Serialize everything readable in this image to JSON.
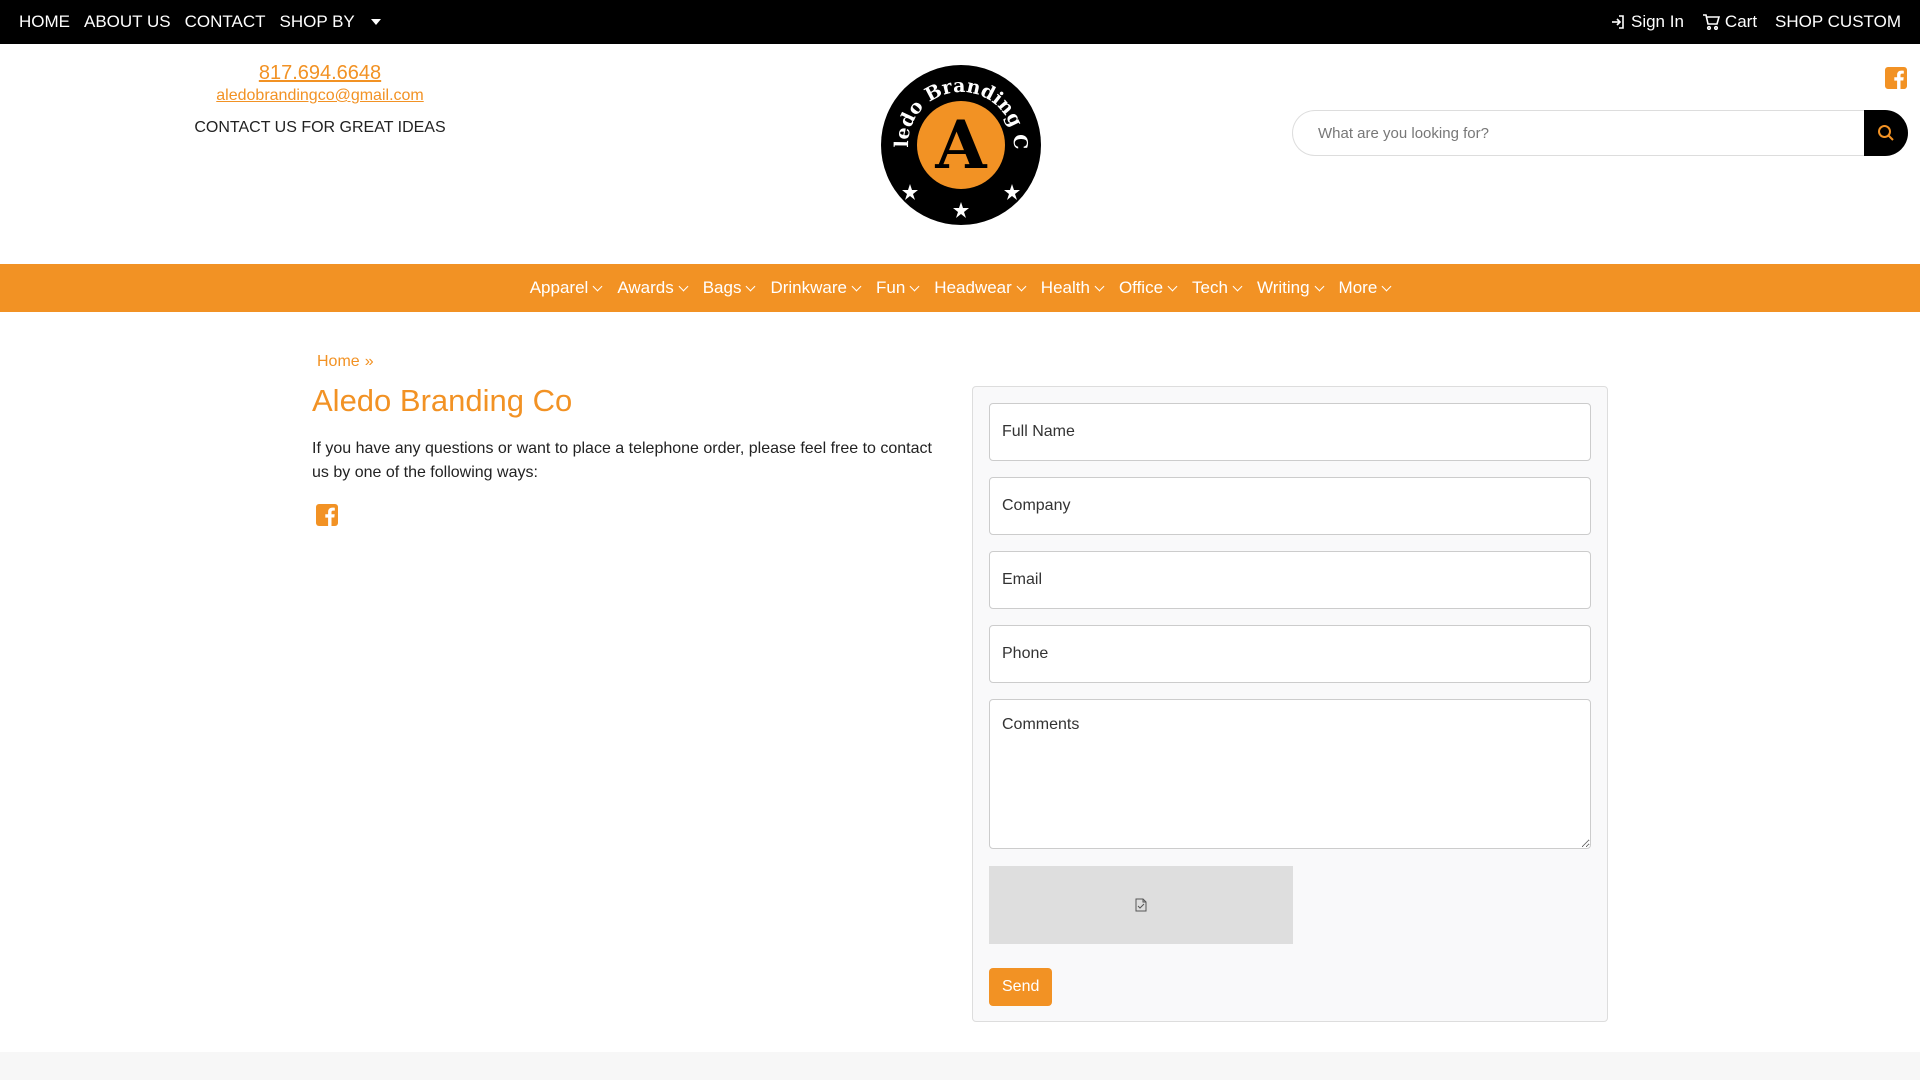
{
  "topbar": {
    "home": "HOME",
    "about": "ABOUT US",
    "contact": "CONTACT",
    "shop_by": "SHOP BY",
    "sign_in": "Sign In",
    "cart": "Cart",
    "shop_custom": "SHOP CUSTOM"
  },
  "header": {
    "phone": "817.694.6648",
    "email": "aledobrandingco@gmail.com",
    "tagline": "CONTACT US FOR GREAT IDEAS",
    "logo_text": "Aledo Branding Co",
    "logo_letter": "A",
    "search_placeholder": "What are you looking for?"
  },
  "categories": [
    "Apparel",
    "Awards",
    "Bags",
    "Drinkware",
    "Fun",
    "Headwear",
    "Health",
    "Office",
    "Tech",
    "Writing",
    "More"
  ],
  "breadcrumb": {
    "home": "Home",
    "sep": "»"
  },
  "main": {
    "title": "Aledo Branding Co",
    "intro": "If you have any questions or want to place a telephone order, please feel free to contact us by one of the following ways:"
  },
  "form": {
    "full_name": "Full Name",
    "company": "Company",
    "email": "Email",
    "phone": "Phone",
    "comments": "Comments",
    "send": "Send"
  },
  "colors": {
    "accent": "#f29224",
    "topbar": "#000000"
  }
}
